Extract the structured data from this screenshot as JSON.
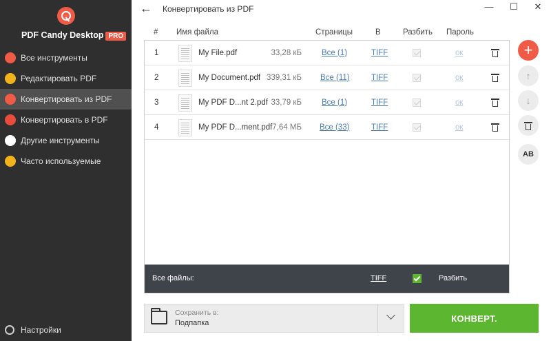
{
  "sidebar": {
    "brand": "PDF Candy Desktop",
    "pro_badge": "PRO",
    "items": [
      {
        "label": "Все инструменты",
        "color": "#ef5b46"
      },
      {
        "label": "Редактировать PDF",
        "color": "#f2b21b"
      },
      {
        "label": "Конвертировать из PDF",
        "color": "#ef5b46",
        "active": true
      },
      {
        "label": "Конвертировать в PDF",
        "color": "#e84c3d"
      },
      {
        "label": "Другие инструменты",
        "color": "#ffffff"
      },
      {
        "label": "Часто используемые",
        "color": "#f2b21b"
      }
    ],
    "settings_label": "Настройки"
  },
  "header": {
    "back_arrow": "←",
    "title": "Конвертировать из PDF",
    "minimize": "—",
    "maximize": "☐",
    "close": "✕"
  },
  "table": {
    "columns": [
      "#",
      "Имя файла",
      "Страницы",
      "В",
      "Разбить",
      "Пароль"
    ],
    "rows": [
      {
        "num": "1",
        "name": "My File.pdf",
        "size": "33,28 кБ",
        "pages": "Все (1)",
        "format": "TIFF",
        "password": "ок"
      },
      {
        "num": "2",
        "name": "My Document.pdf",
        "size": "339,31 кБ",
        "pages": "Все (11)",
        "format": "TIFF",
        "password": "ок"
      },
      {
        "num": "3",
        "name": "My PDF D...nt 2.pdf",
        "size": "33,79 кБ",
        "pages": "Все (1)",
        "format": "TIFF",
        "password": "ок"
      },
      {
        "num": "4",
        "name": "My PDF D...ment.pdf",
        "size": "7,64 МБ",
        "pages": "Все (33)",
        "format": "TIFF",
        "password": "ок"
      }
    ],
    "footer": {
      "all_files": "Все файлы:",
      "format": "TIFF",
      "split_label": "Разбить"
    }
  },
  "side_buttons": {
    "add": "+",
    "up": "↑",
    "down": "↓",
    "delete": "🗑",
    "rename": "AB"
  },
  "save": {
    "label": "Сохранить в:",
    "value": "Подпапка"
  },
  "convert_button": "КОНВЕРТ.",
  "colors": {
    "sidebar_bg": "#2f2f2f",
    "accent_red": "#ef5b46",
    "accent_green": "#5cb630",
    "footer_bar": "#3f444b",
    "link": "#4a7db5"
  }
}
